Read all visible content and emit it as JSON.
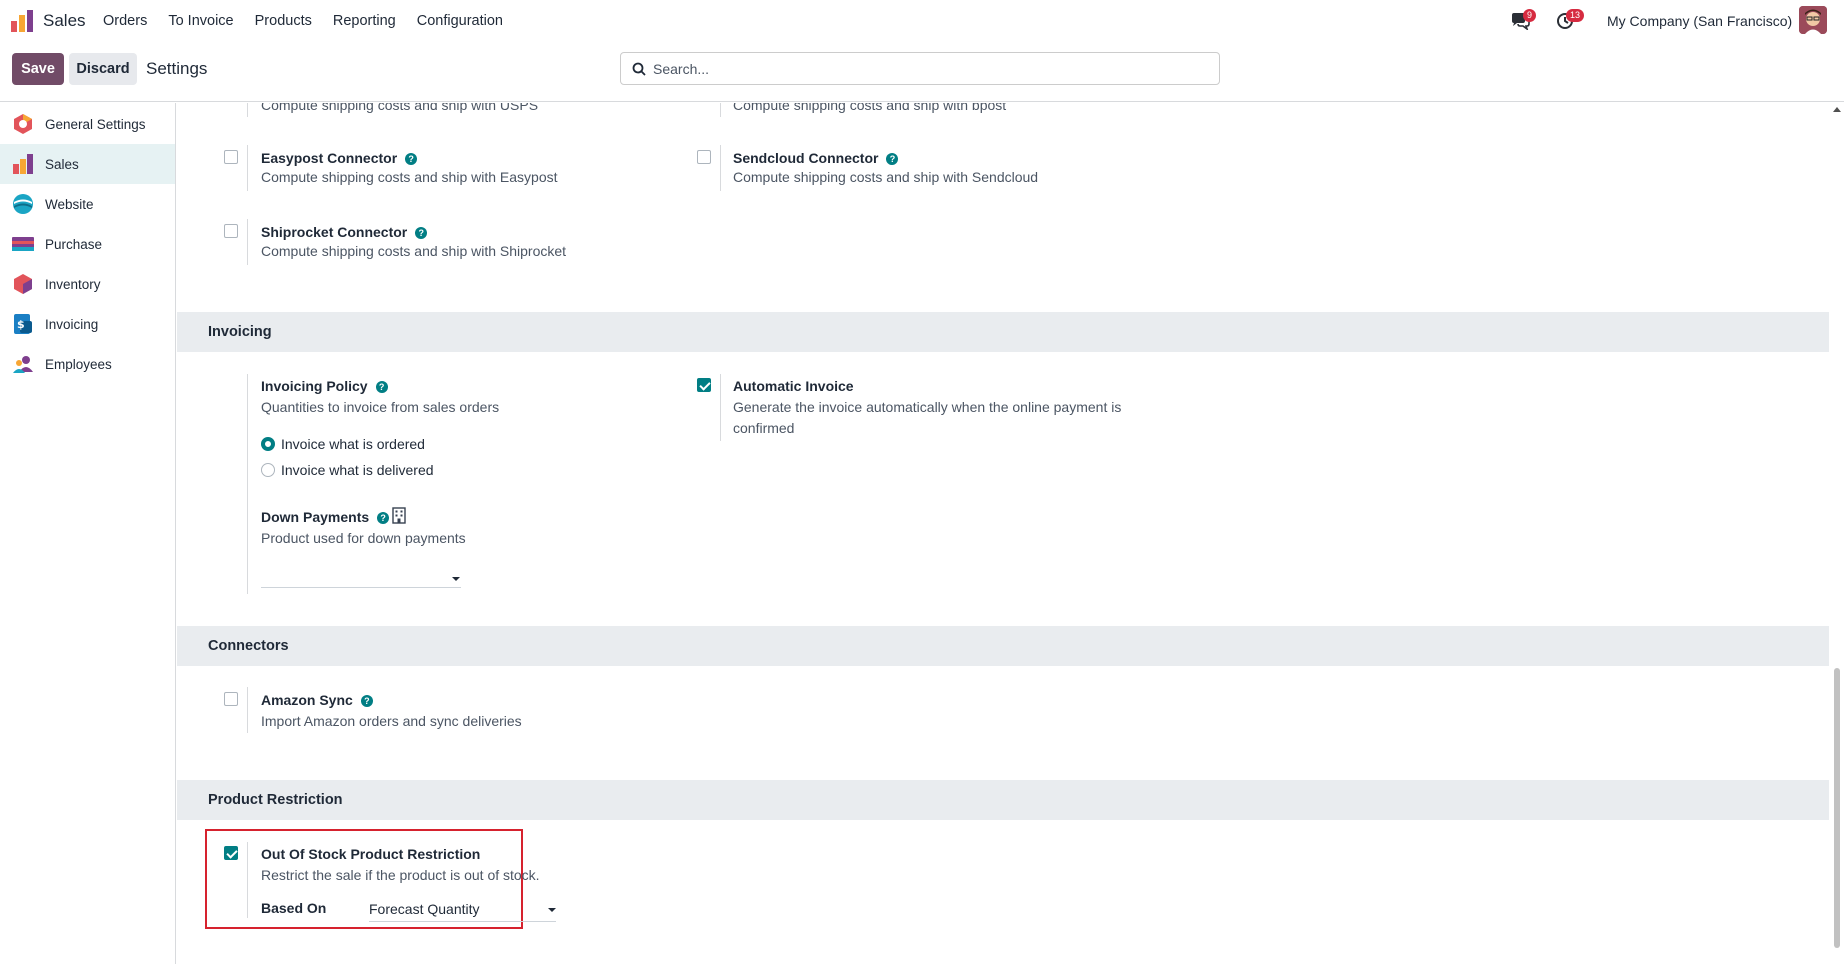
{
  "nav": {
    "app_name": "Sales",
    "menu": [
      "Orders",
      "To Invoice",
      "Products",
      "Reporting",
      "Configuration"
    ],
    "chat_badge": "9",
    "activity_badge": "13",
    "company": "My Company (San Francisco)"
  },
  "control": {
    "save_label": "Save",
    "discard_label": "Discard",
    "breadcrumb": "Settings",
    "search_placeholder": "Search..."
  },
  "sidebar": {
    "items": [
      {
        "label": "General Settings",
        "icon": "general-settings-icon"
      },
      {
        "label": "Sales",
        "icon": "sales-icon",
        "active": true
      },
      {
        "label": "Website",
        "icon": "website-icon"
      },
      {
        "label": "Purchase",
        "icon": "purchase-icon"
      },
      {
        "label": "Inventory",
        "icon": "inventory-icon"
      },
      {
        "label": "Invoicing",
        "icon": "invoicing-icon"
      },
      {
        "label": "Employees",
        "icon": "employees-icon"
      }
    ]
  },
  "shipping": {
    "usps_desc": "Compute shipping costs and ship with USPS",
    "bpost_desc": "Compute shipping costs and ship with bpost",
    "easypost_title": "Easypost Connector",
    "easypost_desc": "Compute shipping costs and ship with Easypost",
    "sendcloud_title": "Sendcloud Connector",
    "sendcloud_desc": "Compute shipping costs and ship with Sendcloud",
    "shiprocket_title": "Shiprocket Connector",
    "shiprocket_desc": "Compute shipping costs and ship with Shiprocket"
  },
  "invoicing": {
    "header": "Invoicing",
    "policy_title": "Invoicing Policy",
    "policy_desc": "Quantities to invoice from sales orders",
    "radio_ordered": "Invoice what is ordered",
    "radio_delivered": "Invoice what is delivered",
    "selected_policy": "Invoice what is ordered",
    "auto_title": "Automatic Invoice",
    "auto_desc_1": "Generate the invoice automatically when the online payment is",
    "auto_desc_2": "confirmed",
    "down_title": "Down Payments",
    "down_desc": "Product used for down payments"
  },
  "connectors": {
    "header": "Connectors",
    "amazon_title": "Amazon Sync",
    "amazon_desc": "Import Amazon orders and sync deliveries"
  },
  "restriction": {
    "header": "Product Restriction",
    "title": "Out Of Stock Product Restriction",
    "desc": "Restrict the sale if the product is out of stock.",
    "based_on_label": "Based On",
    "based_on_value": "Forecast Quantity"
  },
  "colors": {
    "primary": "#714b67",
    "accent": "#017e84",
    "highlight": "#d6222e"
  }
}
